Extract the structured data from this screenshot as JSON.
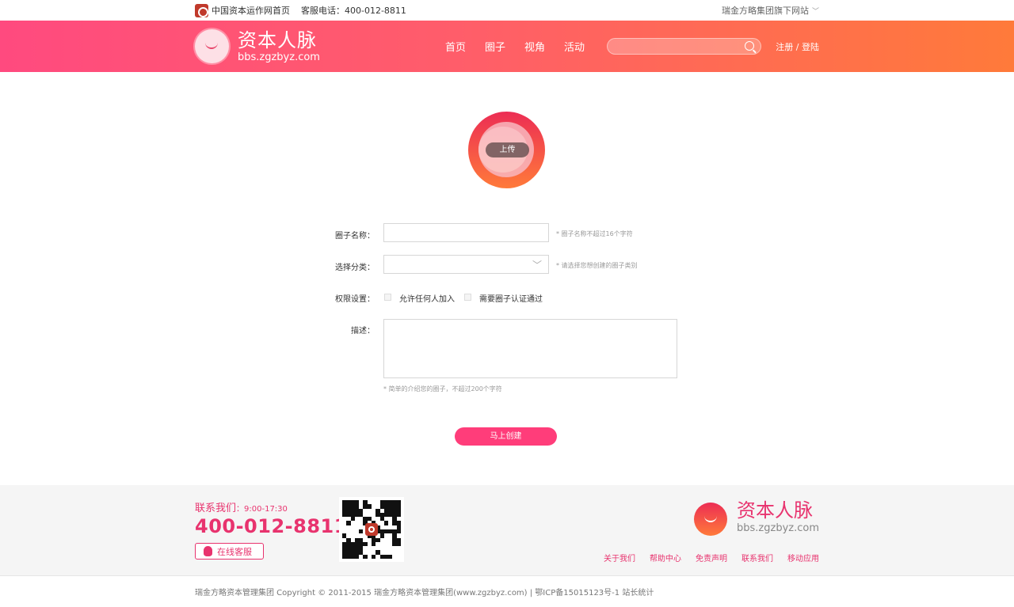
{
  "topbar": {
    "home_link": "中国资本运作网首页",
    "hotline": "客服电话：400-012-8811",
    "group_sites": "瑞金方略集团旗下网站"
  },
  "header": {
    "logo_cn": "资本人脉",
    "logo_en": "bbs.zgzbyz.com",
    "nav": [
      "首页",
      "圈子",
      "视角",
      "活动"
    ],
    "search_placeholder": "",
    "register_login": "注册 / 登陆"
  },
  "form": {
    "upload_label": "上传",
    "name_label": "圈子名称：",
    "name_value": "",
    "name_hint": "* 圈子名称不超过16个字符",
    "category_label": "选择分类：",
    "category_value": "",
    "category_hint": "* 请选择您想创建的圈子类别",
    "permission_label": "权限设置：",
    "permission_options": [
      "允许任何人加入",
      "需要圈子认证通过"
    ],
    "desc_label": "描述：",
    "desc_value": "",
    "desc_hint": "* 简单的介绍您的圈子，不超过200个字符",
    "submit_label": "马上创建"
  },
  "footer": {
    "contact_title": "联系我们",
    "contact_hours": "：9:00-17:30",
    "phone": "400-012-8811",
    "online_service": "在线客服",
    "logo_cn": "资本人脉",
    "logo_en": "bbs.zgzbyz.com",
    "links": [
      "关于我们",
      "帮助中心",
      "免责声明",
      "联系我们",
      "移动应用"
    ],
    "copyright": "瑞金方略资本管理集团  Copyright © 2011-2015 瑞金方略资本管理集团(www.zgzbyz.com) | 鄂ICP备15015123号-1 站长统计"
  },
  "colors": {
    "brand_pink": "#ff4a7f",
    "brand_orange": "#ff7a3a",
    "accent": "#e8336e"
  }
}
